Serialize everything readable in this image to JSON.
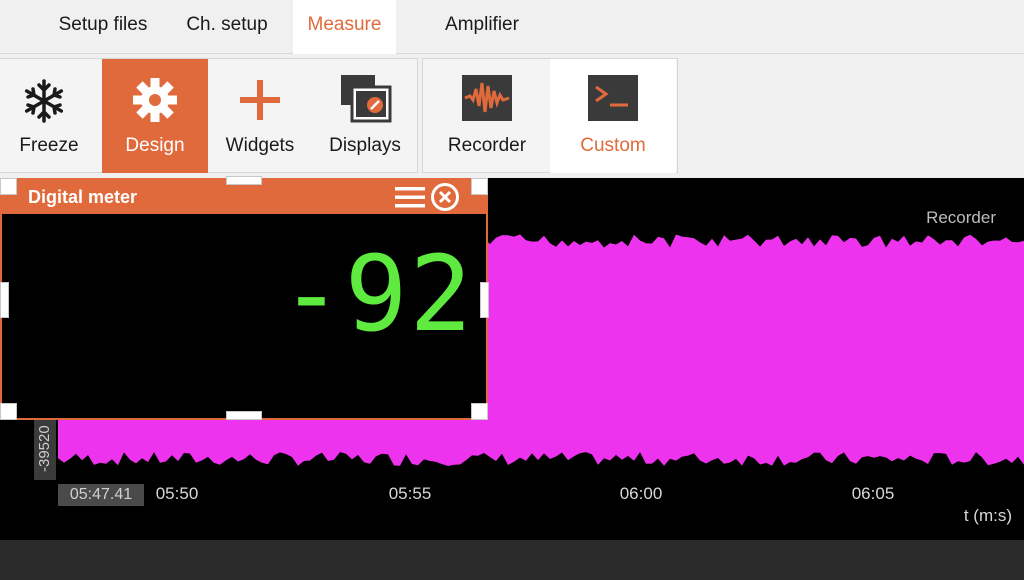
{
  "menu": {
    "tabs": [
      {
        "label": "Setup files"
      },
      {
        "label": "Ch. setup"
      },
      {
        "label": "Measure",
        "active": true
      },
      {
        "label": "Amplifier"
      }
    ]
  },
  "ribbon": {
    "buttons": [
      {
        "label": "Freeze",
        "icon": "snowflake-icon"
      },
      {
        "label": "Design",
        "icon": "gear-icon",
        "state": "active"
      },
      {
        "label": "Widgets",
        "icon": "plus-icon"
      },
      {
        "label": "Displays",
        "icon": "displays-icon"
      },
      {
        "label": "Recorder",
        "icon": "waveform-icon"
      },
      {
        "label": "Custom",
        "icon": "terminal-icon",
        "state": "highlighted"
      }
    ]
  },
  "plot": {
    "title": "Recorder",
    "y_value": "-39520",
    "cursor_time": "05:47.41",
    "x_ticks": [
      "05:50",
      "05:55",
      "06:00",
      "06:05"
    ],
    "x_unit": "t (m:s)",
    "signal_color": "#ee33ee"
  },
  "meter": {
    "title": "Digital meter",
    "value": "-92",
    "value_color": "#5fea3f"
  },
  "colors": {
    "accent": "#e06a3b",
    "background": "#000000",
    "ribbon": "#f0f0f0"
  }
}
